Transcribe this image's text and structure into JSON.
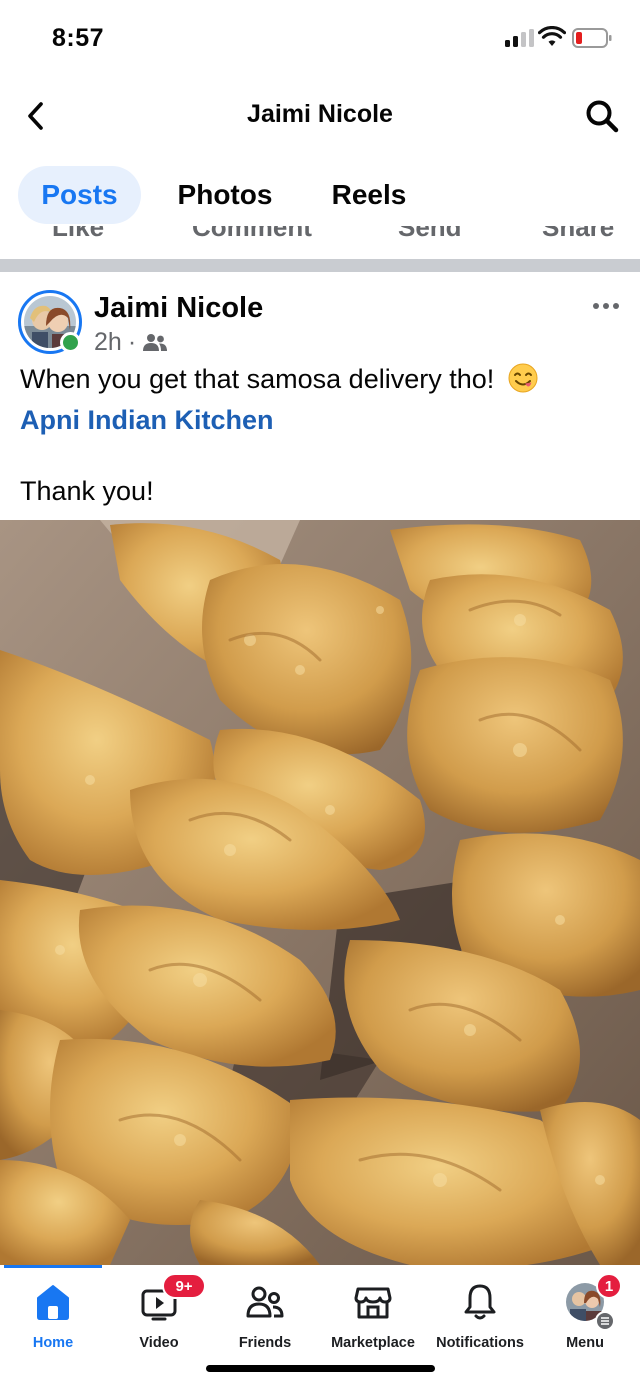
{
  "status_bar": {
    "time": "8:57"
  },
  "header": {
    "title": "Jaimi Nicole"
  },
  "tabs": [
    {
      "label": "Posts",
      "active": true
    },
    {
      "label": "Photos",
      "active": false
    },
    {
      "label": "Reels",
      "active": false
    }
  ],
  "previous_post_actions": [
    "Like",
    "Comment",
    "Send",
    "Share"
  ],
  "post": {
    "author": "Jaimi Nicole",
    "time": "2h",
    "separator": "·",
    "audience_icon": "friends-audience-icon",
    "text_line1": "When you get that samosa delivery tho!",
    "text_emoji": "😋",
    "link_text": "Apni Indian Kitchen",
    "text_line3": "Thank you!"
  },
  "bottom_nav": {
    "items": [
      {
        "label": "Home",
        "active": true
      },
      {
        "label": "Video",
        "badge": "9+"
      },
      {
        "label": "Friends"
      },
      {
        "label": "Marketplace"
      },
      {
        "label": "Notifications"
      },
      {
        "label": "Menu",
        "badge": "1"
      }
    ]
  },
  "colors": {
    "accent": "#1877f2",
    "link": "#1d5fb4",
    "badge": "#e41e3f",
    "online": "#31a24c",
    "battery_low": "#e41e1e"
  }
}
